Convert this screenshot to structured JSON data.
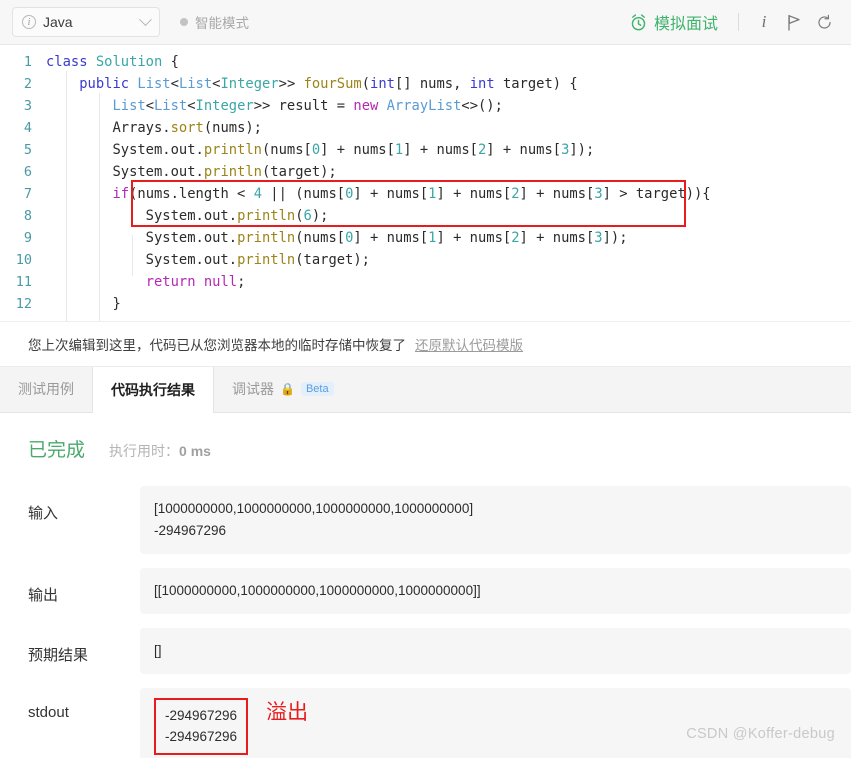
{
  "toolbar": {
    "language": "Java",
    "language_icon": "info-circle-icon",
    "smart_mode": "智能模式",
    "mock_interview": "模拟面试",
    "alarm_icon": "alarm-clock-icon",
    "info_icon": "info-icon",
    "run_icon": "flag-run-icon",
    "reset_icon": "reset-undo-icon",
    "accent_green": "#3fb36c"
  },
  "editor": {
    "lines": [
      {
        "n": "1",
        "tokens": [
          {
            "t": "class ",
            "c": "kw"
          },
          {
            "t": "Solution",
            "c": "type2"
          },
          {
            "t": " {",
            "c": "op"
          }
        ],
        "indent": 0
      },
      {
        "n": "2",
        "tokens": [
          {
            "t": "    ",
            "c": "op"
          },
          {
            "t": "public",
            "c": "kw"
          },
          {
            "t": " ",
            "c": "op"
          },
          {
            "t": "List",
            "c": "type"
          },
          {
            "t": "<",
            "c": "op"
          },
          {
            "t": "List",
            "c": "type"
          },
          {
            "t": "<",
            "c": "op"
          },
          {
            "t": "Integer",
            "c": "type2"
          },
          {
            "t": ">> ",
            "c": "op"
          },
          {
            "t": "fourSum",
            "c": "fn"
          },
          {
            "t": "(",
            "c": "op"
          },
          {
            "t": "int",
            "c": "kw"
          },
          {
            "t": "[] nums, ",
            "c": "op"
          },
          {
            "t": "int",
            "c": "kw"
          },
          {
            "t": " target) {",
            "c": "op"
          }
        ],
        "indent": 1
      },
      {
        "n": "3",
        "tokens": [
          {
            "t": "        ",
            "c": "op"
          },
          {
            "t": "List",
            "c": "type"
          },
          {
            "t": "<",
            "c": "op"
          },
          {
            "t": "List",
            "c": "type"
          },
          {
            "t": "<",
            "c": "op"
          },
          {
            "t": "Integer",
            "c": "type2"
          },
          {
            "t": ">> result = ",
            "c": "op"
          },
          {
            "t": "new",
            "c": "kw2"
          },
          {
            "t": " ",
            "c": "op"
          },
          {
            "t": "ArrayList",
            "c": "type"
          },
          {
            "t": "<>();",
            "c": "op"
          }
        ],
        "indent": 2
      },
      {
        "n": "4",
        "tokens": [
          {
            "t": "        Arrays.",
            "c": "op"
          },
          {
            "t": "sort",
            "c": "fn"
          },
          {
            "t": "(nums);",
            "c": "op"
          }
        ],
        "indent": 2
      },
      {
        "n": "5",
        "tokens": [
          {
            "t": "        System.out.",
            "c": "op"
          },
          {
            "t": "println",
            "c": "fn"
          },
          {
            "t": "(nums[",
            "c": "op"
          },
          {
            "t": "0",
            "c": "num"
          },
          {
            "t": "] + nums[",
            "c": "op"
          },
          {
            "t": "1",
            "c": "num"
          },
          {
            "t": "] + nums[",
            "c": "op"
          },
          {
            "t": "2",
            "c": "num"
          },
          {
            "t": "] + nums[",
            "c": "op"
          },
          {
            "t": "3",
            "c": "num"
          },
          {
            "t": "]);",
            "c": "op"
          }
        ],
        "indent": 2
      },
      {
        "n": "6",
        "tokens": [
          {
            "t": "        System.out.",
            "c": "op"
          },
          {
            "t": "println",
            "c": "fn"
          },
          {
            "t": "(target);",
            "c": "op"
          }
        ],
        "indent": 2
      },
      {
        "n": "7",
        "tokens": [
          {
            "t": "        ",
            "c": "op"
          },
          {
            "t": "if",
            "c": "ctrl"
          },
          {
            "t": "(nums.length < ",
            "c": "op"
          },
          {
            "t": "4",
            "c": "num"
          },
          {
            "t": " || (nums[",
            "c": "op"
          },
          {
            "t": "0",
            "c": "num"
          },
          {
            "t": "] + nums[",
            "c": "op"
          },
          {
            "t": "1",
            "c": "num"
          },
          {
            "t": "] + nums[",
            "c": "op"
          },
          {
            "t": "2",
            "c": "num"
          },
          {
            "t": "] + nums[",
            "c": "op"
          },
          {
            "t": "3",
            "c": "num"
          },
          {
            "t": "] > target)){",
            "c": "op"
          }
        ],
        "indent": 2
      },
      {
        "n": "8",
        "tokens": [
          {
            "t": "            System.out.",
            "c": "op"
          },
          {
            "t": "println",
            "c": "fn"
          },
          {
            "t": "(",
            "c": "op"
          },
          {
            "t": "6",
            "c": "num"
          },
          {
            "t": ");",
            "c": "op"
          }
        ],
        "indent": 3
      },
      {
        "n": "9",
        "tokens": [
          {
            "t": "            System.out.",
            "c": "op"
          },
          {
            "t": "println",
            "c": "fn"
          },
          {
            "t": "(nums[",
            "c": "op"
          },
          {
            "t": "0",
            "c": "num"
          },
          {
            "t": "] + nums[",
            "c": "op"
          },
          {
            "t": "1",
            "c": "num"
          },
          {
            "t": "] + nums[",
            "c": "op"
          },
          {
            "t": "2",
            "c": "num"
          },
          {
            "t": "] + nums[",
            "c": "op"
          },
          {
            "t": "3",
            "c": "num"
          },
          {
            "t": "]);",
            "c": "op"
          }
        ],
        "indent": 3
      },
      {
        "n": "10",
        "tokens": [
          {
            "t": "            System.out.",
            "c": "op"
          },
          {
            "t": "println",
            "c": "fn"
          },
          {
            "t": "(target);",
            "c": "op"
          }
        ],
        "indent": 3
      },
      {
        "n": "11",
        "tokens": [
          {
            "t": "            ",
            "c": "op"
          },
          {
            "t": "return",
            "c": "kw2"
          },
          {
            "t": " ",
            "c": "op"
          },
          {
            "t": "null",
            "c": "kw2"
          },
          {
            "t": ";",
            "c": "op"
          }
        ],
        "indent": 3
      },
      {
        "n": "12",
        "tokens": [
          {
            "t": "        }",
            "c": "op"
          }
        ],
        "indent": 2
      }
    ],
    "highlight_box": {
      "color": "#e81c1c",
      "covers_lines": "5-6"
    }
  },
  "notice": {
    "text": "您上次编辑到这里，代码已从您浏览器本地的临时存储中恢复了",
    "link": "还原默认代码模版"
  },
  "tabs": [
    {
      "label": "测试用例",
      "active": false,
      "lock": false,
      "badge": ""
    },
    {
      "label": "代码执行结果",
      "active": true,
      "lock": false,
      "badge": ""
    },
    {
      "label": "调试器",
      "active": false,
      "lock": true,
      "badge": "Beta"
    }
  ],
  "result": {
    "status": "已完成",
    "status_color": "#4ba96c",
    "runtime_label": "执行用时：",
    "runtime_value": "0 ms",
    "rows": [
      {
        "key": "输入",
        "lines": [
          "[1000000000,1000000000,1000000000,1000000000]",
          "-294967296"
        ],
        "boxed": false
      },
      {
        "key": "输出",
        "lines": [
          "[[1000000000,1000000000,1000000000,1000000000]]"
        ],
        "boxed": false
      },
      {
        "key": "预期结果",
        "lines": [
          "[]"
        ],
        "boxed": false
      },
      {
        "key": "stdout",
        "lines": [
          "-294967296",
          "-294967296"
        ],
        "boxed": true,
        "annotation": "溢出",
        "annotation_color": "#e81c1c"
      }
    ]
  },
  "watermark": "CSDN @Koffer-debug"
}
